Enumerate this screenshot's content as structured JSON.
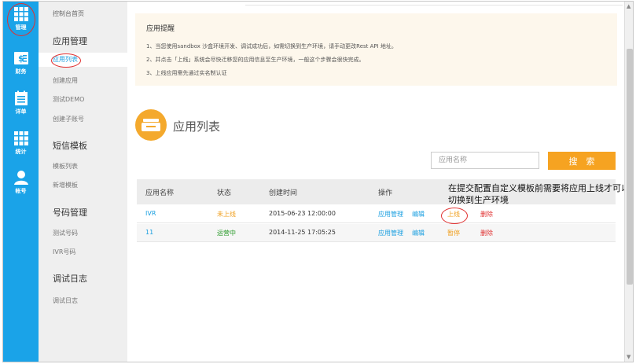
{
  "rail": {
    "items": [
      {
        "label": "管理",
        "icon": "grid-icon"
      },
      {
        "label": "财务",
        "icon": "finance-icon"
      },
      {
        "label": "详单",
        "icon": "list-icon"
      },
      {
        "label": "统计",
        "icon": "stats-icon"
      },
      {
        "label": "帐号",
        "icon": "user-icon"
      }
    ]
  },
  "menu": {
    "home": "控制台首页",
    "sections": [
      {
        "title": "应用管理",
        "items": [
          "应用列表",
          "创建应用",
          "测试DEMO",
          "创建子账号"
        ]
      },
      {
        "title": "短信模板",
        "items": [
          "模板列表",
          "新增模板"
        ]
      },
      {
        "title": "号码管理",
        "items": [
          "测试号码",
          "IVR号码"
        ]
      },
      {
        "title": "调试日志",
        "items": [
          "调试日志"
        ]
      }
    ],
    "active_item": "应用列表"
  },
  "notice": {
    "title": "应用提醒",
    "lines": [
      "1、当您使用sandbox 沙盒环境开发、调试成功后，如需切换到生产环境，请手动更改Rest API 地址。",
      "2、并点击「上线」系统会尽快迁移您的应用信息至生产环境，一般这个步骤会很快完成。",
      "3、上线应用需先通过实名制认证"
    ]
  },
  "list": {
    "title": "应用列表",
    "search_placeholder": "应用名称",
    "search_button": "搜　索",
    "columns": [
      "应用名称",
      "状态",
      "创建时间",
      "操作"
    ],
    "rows": [
      {
        "name": "IVR",
        "status": "未上线",
        "created": "2015-06-23 12:00:00",
        "manage": "应用管理",
        "edit": "编辑",
        "toggle": "上线",
        "delete": "删除"
      },
      {
        "name": "11",
        "status": "运营中",
        "created": "2014-11-25 17:05:25",
        "manage": "应用管理",
        "edit": "编辑",
        "toggle": "暂停",
        "delete": "删除"
      }
    ]
  },
  "annotation": "在提交配置自定义模板前需要将应用上线才可以切换到生产环境",
  "colors": {
    "rail": "#1aa3e8",
    "accent": "#f6a321",
    "link": "#1a9fe0",
    "notice_bg": "#fdf7ec",
    "annotation_circle": "#e03030"
  }
}
